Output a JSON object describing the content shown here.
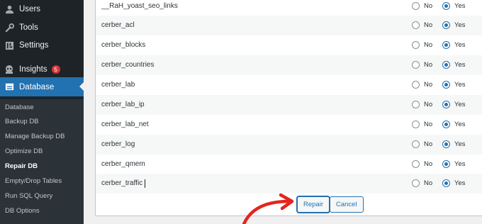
{
  "sidebar": {
    "menu": [
      {
        "label": "Users",
        "icon": "users-icon"
      },
      {
        "label": "Tools",
        "icon": "tools-icon"
      },
      {
        "label": "Settings",
        "icon": "settings-icon"
      },
      {
        "label": "Insights",
        "icon": "insights-icon",
        "badge": "5"
      },
      {
        "label": "Database",
        "icon": "database-icon",
        "active": true
      }
    ],
    "submenu": [
      {
        "label": "Database"
      },
      {
        "label": "Backup DB"
      },
      {
        "label": "Manage Backup DB"
      },
      {
        "label": "Optimize DB"
      },
      {
        "label": "Repair DB",
        "current": true
      },
      {
        "label": "Empty/Drop Tables"
      },
      {
        "label": "Run SQL Query"
      },
      {
        "label": "DB Options"
      }
    ]
  },
  "tables": {
    "no_label": "No",
    "yes_label": "Yes",
    "rows": [
      {
        "name": "__RaH_yoast_seo_links",
        "selected": "yes"
      },
      {
        "name": "cerber_acl",
        "selected": "yes"
      },
      {
        "name": "cerber_blocks",
        "selected": "yes"
      },
      {
        "name": "cerber_countries",
        "selected": "yes"
      },
      {
        "name": "cerber_lab",
        "selected": "yes"
      },
      {
        "name": "cerber_lab_ip",
        "selected": "yes"
      },
      {
        "name": "cerber_lab_net",
        "selected": "yes"
      },
      {
        "name": "cerber_log",
        "selected": "yes"
      },
      {
        "name": "cerber_qmem",
        "selected": "yes"
      },
      {
        "name": "cerber_traffic",
        "selected": "yes"
      }
    ]
  },
  "actions": {
    "repair_label": "Repair",
    "cancel_label": "Cancel"
  },
  "colors": {
    "sidebar_bg": "#1d2327",
    "accent": "#2271b1",
    "badge": "#d63638",
    "annotation_arrow": "#e2261f"
  }
}
